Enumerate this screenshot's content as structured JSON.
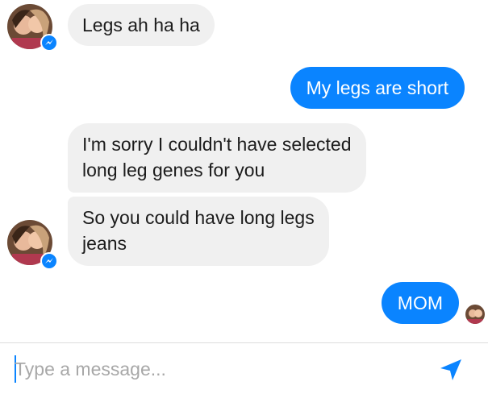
{
  "conversation": {
    "messages": [
      {
        "sender": "other",
        "text": "Legs ah ha ha"
      },
      {
        "sender": "self",
        "text": "My legs are short"
      },
      {
        "sender": "other",
        "lines": [
          "I'm sorry I couldn't have selected",
          "long leg genes for you"
        ]
      },
      {
        "sender": "other",
        "lines": [
          "So you could have long legs",
          "jeans"
        ]
      },
      {
        "sender": "self",
        "text": "MOM"
      }
    ]
  },
  "composer": {
    "placeholder": "Type a message...",
    "value": "",
    "send_icon": "send-arrow-icon"
  },
  "icons": {
    "avatar_badge": "messenger-bolt-icon"
  },
  "colors": {
    "outgoing_bubble": "#0a84ff",
    "incoming_bubble": "#f0f0f0",
    "accent": "#0a84ff"
  }
}
